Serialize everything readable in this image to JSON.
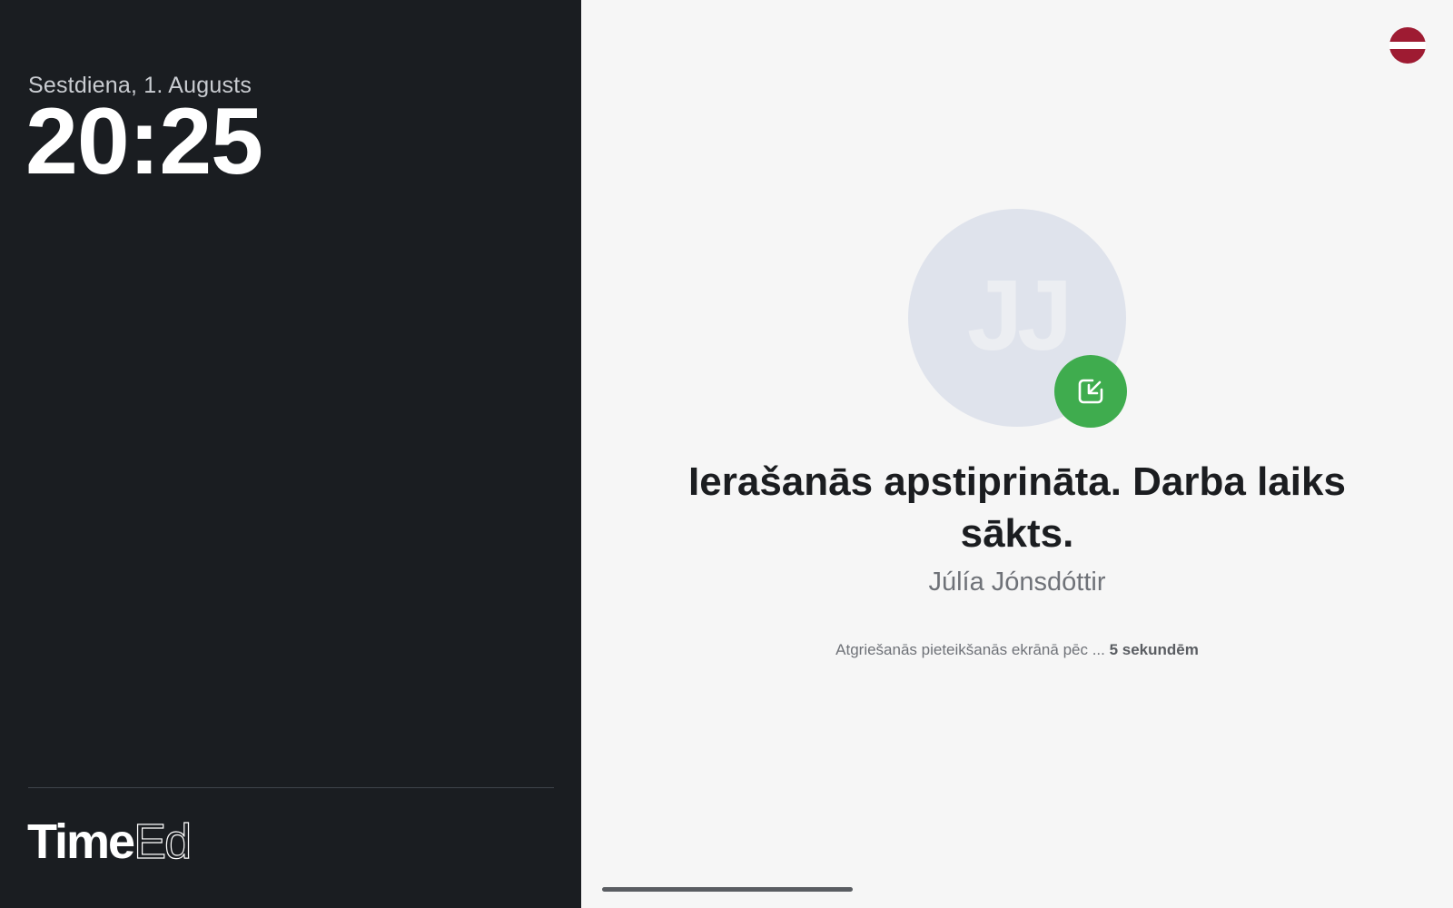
{
  "clock": {
    "date": "Sestdiena, 1. Augusts",
    "time": "20:25"
  },
  "brand": {
    "logo_bold": "Time",
    "logo_thin": "Ed"
  },
  "language": {
    "flag": "latvia-flag-icon"
  },
  "confirmation": {
    "avatar_initials": "JJ",
    "badge_icon": "check-in-arrow-icon",
    "headline": "Ierašanās apstiprināta. Darba laiks sākts.",
    "employee_name": "Júlía Jónsdóttir",
    "countdown_prefix": "Atgriešanās pieteikšanās ekrānā pēc ... ",
    "countdown_value": "5 sekundēm"
  },
  "colors": {
    "left_panel": "#1a1d21",
    "right_panel": "#f6f6f6",
    "badge_green": "#3fac4e",
    "flag_red": "#9e1b32"
  }
}
